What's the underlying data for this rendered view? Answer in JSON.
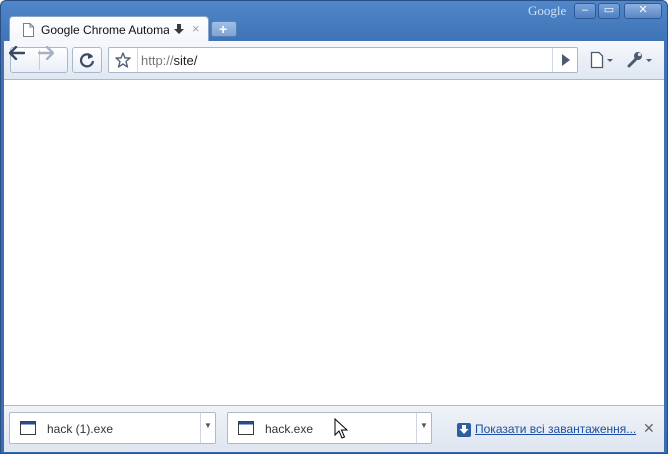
{
  "window": {
    "brand": "Google",
    "controls": {
      "minimize": "‒",
      "maximize": "▭",
      "close": "✕"
    }
  },
  "tab": {
    "title": "Google Chrome Automa...",
    "close": "×"
  },
  "new_tab": {
    "label": "+"
  },
  "omnibox": {
    "url_scheme": "http://",
    "url_host": "site/"
  },
  "downloads": [
    {
      "filename": "hack (1).exe"
    },
    {
      "filename": "hack.exe"
    }
  ],
  "shelf": {
    "show_all_label": "Показати всі завантаження...",
    "close": "✕"
  },
  "colors": {
    "frame": "#3f74b6",
    "link": "#1c4fa3"
  }
}
